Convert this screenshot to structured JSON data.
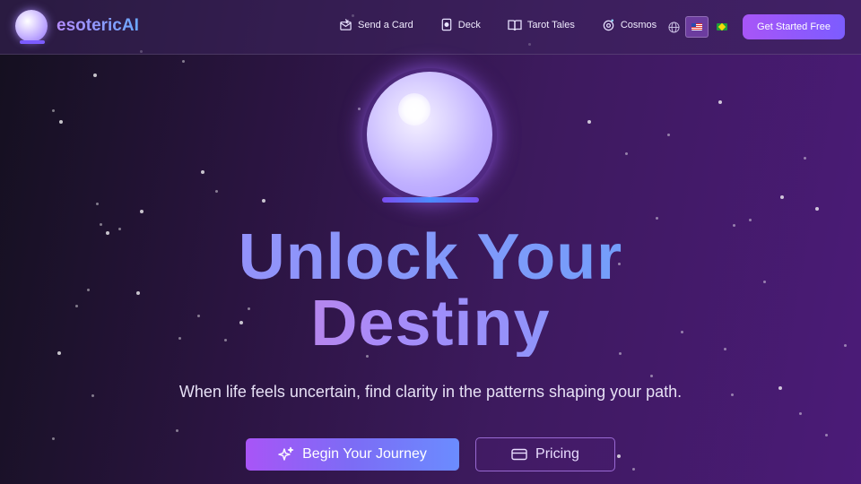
{
  "brand": {
    "name": "esotericAI"
  },
  "nav": {
    "items": [
      {
        "label": "Send a Card",
        "icon": "envelope-star-icon"
      },
      {
        "label": "Deck",
        "icon": "tarot-card-icon"
      },
      {
        "label": "Tarot Tales",
        "icon": "open-book-icon"
      },
      {
        "label": "Cosmos",
        "icon": "cosmos-orbit-icon"
      }
    ],
    "language_icon": "globe-icon",
    "languages": [
      {
        "code": "en-US",
        "icon": "us-flag-icon",
        "selected": true
      },
      {
        "code": "pt-BR",
        "icon": "brazil-flag-icon",
        "selected": false
      }
    ],
    "cta_label": "Get Started Free"
  },
  "hero": {
    "title_line1": "Unlock Your",
    "title_line2": "Destiny",
    "subtitle": "When life feels uncertain, find clarity in the patterns shaping your path.",
    "primary_button_label": "Begin Your Journey",
    "primary_button_icon": "sparkles-icon",
    "secondary_button_label": "Pricing",
    "secondary_button_icon": "credit-card-icon"
  },
  "colors": {
    "accent_purple": "#a855f7",
    "accent_blue": "#60a5fa",
    "accent_pink": "#f472b6",
    "background_dark": "#14101f",
    "background_purple": "#4b1b78"
  }
}
